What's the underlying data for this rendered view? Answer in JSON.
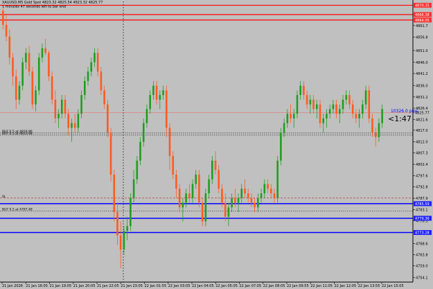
{
  "header": {
    "symbol_line": "XAUUSD,M5  Gold Spot  4823.32 4825.54 4823.32 4825.77",
    "timer_line": "1 minutes 47 seconds left to bar end"
  },
  "countdown": "<1:47",
  "pips_label": "10326.0 pips",
  "colors": {
    "background": "#c0c0c0",
    "bull": "#1e9e1e",
    "bear": "#ff5a1e",
    "hline_red": "#ff0000",
    "hline_blue": "#0000ff",
    "bid_line": "#e08080",
    "price_tag_red": "#ff3030",
    "price_tag_blue": "#2020ff"
  },
  "orders": [
    {
      "label": "BUY 0.5 at 4819.96",
      "price": 4815.8
    },
    {
      "label": "BUY 0.5 at 4813.98",
      "price": 4814.9
    },
    {
      "label": "SL",
      "price": 4788.0
    },
    {
      "label": "BUY 0.5 at 4787.48",
      "price": 4782.5
    }
  ],
  "hlines": [
    {
      "price": 4870.35,
      "color": "red",
      "tag": "4870.35"
    },
    {
      "price": 4866.38,
      "color": "red",
      "tag": "4866.38"
    },
    {
      "price": 4864.05,
      "color": "red",
      "tag": "4864.05"
    },
    {
      "price": 4824.52,
      "color": "bid",
      "tag": "4825.77"
    },
    {
      "price": 4785.59,
      "color": "blue",
      "tag": "4785.59"
    },
    {
      "price": 4779.36,
      "color": "blue",
      "tag": "4779.36"
    },
    {
      "price": 4773.28,
      "color": "blue",
      "tag": "4773.28"
    }
  ],
  "chart_data": {
    "type": "candlestick",
    "ylim": [
      4752.7,
      4872.0
    ],
    "price_axis_ticks": [
      4861.7,
      4856.8,
      4851.0,
      4846.0,
      4841.2,
      4836.0,
      4831.2,
      4826.4,
      4821.6,
      4817.0,
      4812.0,
      4807.3,
      4802.4,
      4797.6,
      4792.8,
      4787.9,
      4783.1,
      4778.3,
      4773.5,
      4768.6,
      4763.8,
      4759.0,
      4754.1
    ],
    "time_labels": [
      "21 Jan 2026",
      "21 Jan 16:05",
      "21 Jan 19:05",
      "21 Jan 20:05",
      "21 Jan 22:05",
      "21 Jan 23:05",
      "22 Jan 01:55",
      "22 Jan 03:05",
      "22 Jan 04:05",
      "22 Jan 05:05",
      "22 Jan 07:05",
      "22 Jan 08:05",
      "22 Jan 09:55",
      "22 Jan 11:05",
      "22 Jan 12:05",
      "22 Jan 13:55",
      "22 Jan 15:05"
    ],
    "ohlc": [
      [
        4868,
        4869,
        4860,
        4862
      ],
      [
        4862,
        4866,
        4855,
        4857
      ],
      [
        4857,
        4860,
        4845,
        4848
      ],
      [
        4848,
        4850,
        4836,
        4840
      ],
      [
        4840,
        4843,
        4826,
        4830
      ],
      [
        4830,
        4838,
        4828,
        4836
      ],
      [
        4836,
        4848,
        4834,
        4846
      ],
      [
        4846,
        4852,
        4843,
        4850
      ],
      [
        4850,
        4853,
        4840,
        4842
      ],
      [
        4842,
        4844,
        4826,
        4828
      ],
      [
        4828,
        4836,
        4825,
        4834
      ],
      [
        4834,
        4850,
        4832,
        4848
      ],
      [
        4848,
        4854,
        4846,
        4852
      ],
      [
        4852,
        4856,
        4849,
        4850
      ],
      [
        4850,
        4851,
        4838,
        4840
      ],
      [
        4840,
        4842,
        4828,
        4830
      ],
      [
        4830,
        4834,
        4820,
        4822
      ],
      [
        4822,
        4826,
        4818,
        4824
      ],
      [
        4824,
        4832,
        4822,
        4830
      ],
      [
        4830,
        4832,
        4822,
        4824
      ],
      [
        4824,
        4826,
        4815,
        4818
      ],
      [
        4818,
        4822,
        4812,
        4820
      ],
      [
        4820,
        4824,
        4816,
        4818
      ],
      [
        4818,
        4826,
        4816,
        4824
      ],
      [
        4824,
        4834,
        4822,
        4832
      ],
      [
        4832,
        4840,
        4830,
        4838
      ],
      [
        4838,
        4844,
        4836,
        4842
      ],
      [
        4842,
        4848,
        4840,
        4846
      ],
      [
        4846,
        4852,
        4844,
        4850
      ],
      [
        4850,
        4852,
        4840,
        4842
      ],
      [
        4842,
        4844,
        4832,
        4834
      ],
      [
        4834,
        4836,
        4826,
        4828
      ],
      [
        4828,
        4830,
        4814,
        4816
      ],
      [
        4816,
        4818,
        4795,
        4798
      ],
      [
        4798,
        4800,
        4778,
        4782
      ],
      [
        4782,
        4786,
        4768,
        4772
      ],
      [
        4772,
        4778,
        4758,
        4766
      ],
      [
        4766,
        4776,
        4764,
        4774
      ],
      [
        4774,
        4780,
        4770,
        4776
      ],
      [
        4776,
        4790,
        4774,
        4788
      ],
      [
        4788,
        4800,
        4786,
        4796
      ],
      [
        4796,
        4806,
        4794,
        4804
      ],
      [
        4804,
        4814,
        4802,
        4812
      ],
      [
        4812,
        4822,
        4810,
        4820
      ],
      [
        4820,
        4828,
        4818,
        4826
      ],
      [
        4826,
        4834,
        4824,
        4832
      ],
      [
        4832,
        4838,
        4830,
        4836
      ],
      [
        4836,
        4838,
        4828,
        4830
      ],
      [
        4830,
        4834,
        4826,
        4832
      ],
      [
        4832,
        4836,
        4830,
        4834
      ],
      [
        4834,
        4836,
        4814,
        4818
      ],
      [
        4818,
        4820,
        4800,
        4806
      ],
      [
        4806,
        4808,
        4796,
        4798
      ],
      [
        4798,
        4800,
        4788,
        4792
      ],
      [
        4792,
        4794,
        4782,
        4784
      ],
      [
        4784,
        4788,
        4778,
        4786
      ],
      [
        4786,
        4792,
        4784,
        4790
      ],
      [
        4790,
        4794,
        4786,
        4788
      ],
      [
        4788,
        4796,
        4786,
        4794
      ],
      [
        4794,
        4800,
        4792,
        4798
      ],
      [
        4798,
        4800,
        4784,
        4786
      ],
      [
        4786,
        4788,
        4776,
        4778
      ],
      [
        4778,
        4792,
        4776,
        4790
      ],
      [
        4790,
        4798,
        4788,
        4796
      ],
      [
        4796,
        4806,
        4794,
        4804
      ],
      [
        4804,
        4808,
        4798,
        4800
      ],
      [
        4800,
        4802,
        4790,
        4792
      ],
      [
        4792,
        4794,
        4784,
        4786
      ],
      [
        4786,
        4790,
        4778,
        4780
      ],
      [
        4780,
        4786,
        4776,
        4784
      ],
      [
        4784,
        4790,
        4782,
        4788
      ],
      [
        4788,
        4792,
        4784,
        4786
      ],
      [
        4786,
        4790,
        4782,
        4788
      ],
      [
        4788,
        4794,
        4786,
        4792
      ],
      [
        4792,
        4796,
        4788,
        4790
      ],
      [
        4790,
        4792,
        4786,
        4788
      ],
      [
        4788,
        4790,
        4784,
        4786
      ],
      [
        4786,
        4788,
        4782,
        4784
      ],
      [
        4784,
        4790,
        4782,
        4788
      ],
      [
        4788,
        4792,
        4786,
        4790
      ],
      [
        4790,
        4796,
        4788,
        4794
      ],
      [
        4794,
        4796,
        4790,
        4792
      ],
      [
        4792,
        4794,
        4788,
        4790
      ],
      [
        4790,
        4792,
        4786,
        4788
      ],
      [
        4788,
        4806,
        4786,
        4804
      ],
      [
        4804,
        4818,
        4802,
        4816
      ],
      [
        4816,
        4822,
        4814,
        4820
      ],
      [
        4820,
        4826,
        4818,
        4824
      ],
      [
        4824,
        4828,
        4820,
        4822
      ],
      [
        4822,
        4826,
        4818,
        4824
      ],
      [
        4824,
        4834,
        4822,
        4832
      ],
      [
        4832,
        4838,
        4830,
        4836
      ],
      [
        4836,
        4838,
        4830,
        4832
      ],
      [
        4832,
        4834,
        4826,
        4828
      ],
      [
        4828,
        4832,
        4824,
        4830
      ],
      [
        4830,
        4832,
        4824,
        4826
      ],
      [
        4826,
        4830,
        4822,
        4828
      ],
      [
        4828,
        4830,
        4818,
        4820
      ],
      [
        4820,
        4824,
        4816,
        4822
      ],
      [
        4822,
        4826,
        4818,
        4824
      ],
      [
        4824,
        4828,
        4822,
        4826
      ],
      [
        4826,
        4830,
        4824,
        4828
      ],
      [
        4828,
        4830,
        4822,
        4824
      ],
      [
        4824,
        4828,
        4820,
        4826
      ],
      [
        4826,
        4832,
        4824,
        4830
      ],
      [
        4830,
        4834,
        4828,
        4832
      ],
      [
        4832,
        4834,
        4826,
        4828
      ],
      [
        4828,
        4830,
        4822,
        4824
      ],
      [
        4824,
        4826,
        4820,
        4822
      ],
      [
        4822,
        4826,
        4818,
        4824
      ],
      [
        4824,
        4830,
        4822,
        4828
      ],
      [
        4828,
        4836,
        4826,
        4834
      ],
      [
        4834,
        4836,
        4820,
        4822
      ],
      [
        4822,
        4824,
        4814,
        4816
      ],
      [
        4816,
        4818,
        4810,
        4814
      ],
      [
        4814,
        4822,
        4812,
        4820
      ],
      [
        4820,
        4828,
        4818,
        4826
      ]
    ]
  }
}
